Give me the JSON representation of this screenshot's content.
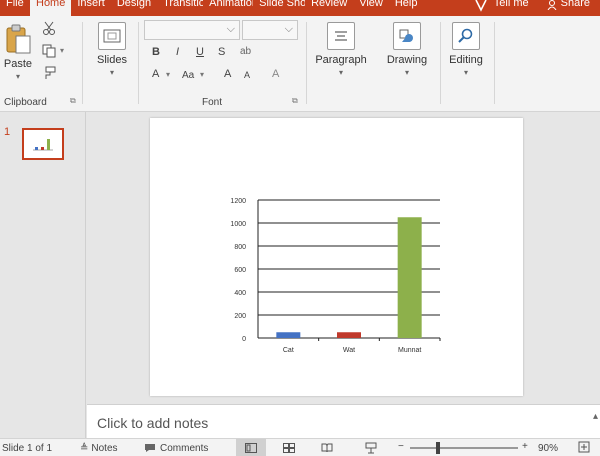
{
  "tabs": [
    {
      "label": "File"
    },
    {
      "label": "Home"
    },
    {
      "label": "Insert"
    },
    {
      "label": "Design"
    },
    {
      "label": "Transitions"
    },
    {
      "label": "Animations"
    },
    {
      "label": "Slide Show"
    },
    {
      "label": "Review"
    },
    {
      "label": "View"
    },
    {
      "label": "Help"
    }
  ],
  "tell_me": "Tell me",
  "share": "Share",
  "ribbon": {
    "clipboard": {
      "paste_label": "Paste",
      "group_label": "Clipboard"
    },
    "slides": {
      "label": "Slides"
    },
    "font": {
      "group_label": "Font",
      "bold": "B",
      "italic": "I",
      "underline": "U",
      "strike": "S",
      "font_color": "A",
      "grow": "A",
      "shrink": "A",
      "clear": "A"
    },
    "paragraph": {
      "label": "Paragraph"
    },
    "drawing": {
      "label": "Drawing"
    },
    "editing": {
      "label": "Editing"
    }
  },
  "thumbnail": {
    "number": "1"
  },
  "chart_data": {
    "type": "bar",
    "categories": [
      "Cat",
      "Wat",
      "Munnat"
    ],
    "values": [
      50,
      50,
      1050
    ],
    "colors": [
      "#4472c4",
      "#c0392b",
      "#8db04b"
    ],
    "yticks": [
      "1200",
      "1000",
      "800",
      "600",
      "400",
      "200",
      "0"
    ],
    "ylim": [
      0,
      1200
    ],
    "grid": true
  },
  "notes": {
    "placeholder": "Click to add notes"
  },
  "status": {
    "slide_counter": "Slide 1 of 1",
    "notes_button": "Notes",
    "comments_button": "Comments",
    "zoom": "90%"
  }
}
